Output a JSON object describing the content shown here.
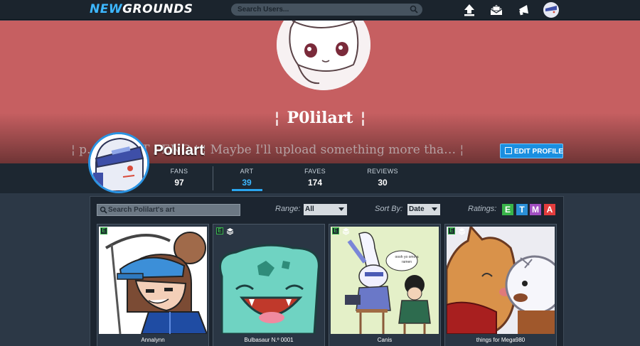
{
  "nav": {
    "logo_new": "NEW",
    "logo_grounds": "GROUNDS",
    "search_placeholder": "Search Users...",
    "icons": [
      "upload-icon",
      "mail-icon",
      "notifications-icon",
      "user-avatar"
    ]
  },
  "banner": {
    "title": "P0lilart",
    "tagline": "¦ p…… PT-PT / ENG ¦ ¦ Maybe I'll upload something more tha… ¦",
    "bg_color": "#c65f61"
  },
  "profile": {
    "username": "Polilart",
    "edit_button": "EDIT PROFILE"
  },
  "stats": [
    {
      "label": "FANS",
      "value": "97"
    },
    {
      "label": "ART",
      "value": "39"
    },
    {
      "label": "FAVES",
      "value": "174"
    },
    {
      "label": "REVIEWS",
      "value": "30"
    }
  ],
  "controls": {
    "search_placeholder": "Search Polilart's art",
    "range_label": "Range:",
    "range_value": "All",
    "sort_label": "Sort By:",
    "sort_value": "Date",
    "ratings_label": "Ratings:",
    "ratings": [
      {
        "letter": "E",
        "color": "#39b54a"
      },
      {
        "letter": "T",
        "color": "#2a8fd6"
      },
      {
        "letter": "M",
        "color": "#a14ec1"
      },
      {
        "letter": "A",
        "color": "#e33d3d"
      }
    ]
  },
  "art": [
    {
      "title": "Annalynn",
      "rating": "E",
      "multi": false
    },
    {
      "title": "Bulbasaur N.º 0001",
      "rating": "E",
      "multi": true
    },
    {
      "title": "Canis",
      "rating": "E",
      "multi": true
    },
    {
      "title": "things for Mega980",
      "rating": "E",
      "multi": true
    }
  ],
  "card3_speech": "oooh yo omo a ramen"
}
